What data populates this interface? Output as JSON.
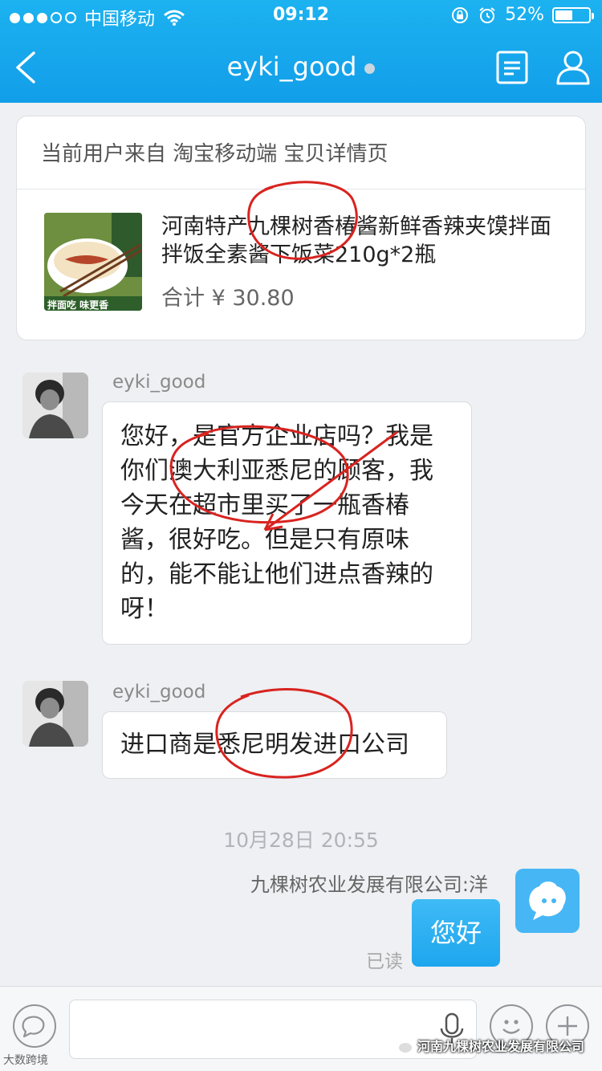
{
  "status_bar": {
    "carrier": "中国移动",
    "time": "09:12",
    "battery": "52%",
    "battery_level": 0.52
  },
  "nav": {
    "title": "eyki_good",
    "back_icon": "chevron-left-icon",
    "doc_icon": "document-icon",
    "user_icon": "user-icon"
  },
  "product_card": {
    "source": "当前用户来自 淘宝移动端 宝贝详情页",
    "title": "河南特产九棵树香椿酱新鲜香辣夹馍拌面拌饭全素酱下饭菜210g*2瓶",
    "price": "合计 ¥ 30.80",
    "thumb_caption": "拌面吃 味更香"
  },
  "messages": [
    {
      "sender": "eyki_good",
      "text": "您好，是官方企业店吗？我是你们澳大利亚悉尼的顾客，我今天在超市里买了一瓶香椿酱，很好吃。但是只有原味的，能不能让他们进点香辣的呀！"
    },
    {
      "sender": "eyki_good",
      "text": "进口商是悉尼明发进口公司"
    }
  ],
  "timestamp": "10月28日 20:55",
  "reply": {
    "company": "九棵树农业发展有限公司:洋",
    "text": "您好",
    "status": "已读"
  },
  "input_bar": {
    "input_value": "",
    "emoji_icon": "smiley-icon",
    "plus_icon": "plus-icon",
    "voice_icon": "chat-bubble-icon",
    "mic_icon": "mic-icon"
  },
  "watermarks": {
    "left": "大数跨境",
    "right": "河南九棵树农业发展有限公司"
  },
  "colors": {
    "header": "#129ee9",
    "my_bubble": "#1ea6ee",
    "annotation": "#d8231f"
  }
}
